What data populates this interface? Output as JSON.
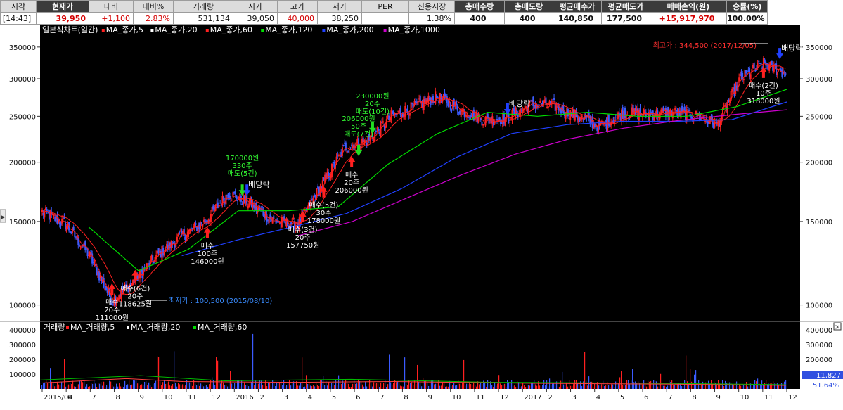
{
  "info_bar": {
    "headers": [
      "시각",
      "현재가",
      "대비",
      "대비%",
      "거래량",
      "시가",
      "고가",
      "저가",
      "PER",
      "신용시장",
      "총매수량",
      "총매도량",
      "평균매수가",
      "평균매도가",
      "매매손익(원)",
      "승률(%)"
    ],
    "values": [
      "[14:43]",
      "39,950",
      "+1,100",
      "2.83%",
      "531,134",
      "39,050",
      "40,000",
      "38,250",
      "",
      "1.38%",
      "400",
      "400",
      "140,850",
      "177,500",
      "+15,917,970",
      "100.00%"
    ]
  },
  "colors": {
    "background": "#000000",
    "candle_up": "#ff2020",
    "candle_down": "#3b5bff",
    "ma5": "#ff2020",
    "ma20": "#ffffff",
    "ma60": "#ff2020",
    "ma120": "#00dd00",
    "ma200": "#2040ff",
    "ma1000": "#cc00cc",
    "buy_arrow": "#ff2020",
    "sell_arrow": "#22dd22",
    "buy_text": "#ffffff",
    "sell_text": "#33ff33",
    "high_label": "#ff3030",
    "low_label": "#3a8cff",
    "volume_line": "#ff4040",
    "volume_ma20": "#00bb00",
    "volume_ma60": "#ffaa00"
  },
  "chart_data": [
    {
      "type": "candlestick",
      "legend": {
        "title": "일본식차트(일간)",
        "items": [
          {
            "label": "MA_종가,5",
            "color": "#ff2020"
          },
          {
            "label": "MA_종가,20",
            "color": "#ffffff"
          },
          {
            "label": "MA_종가,60",
            "color": "#ff2020"
          },
          {
            "label": "MA_종가,120",
            "color": "#00dd00"
          },
          {
            "label": "MA_종가,200",
            "color": "#2040ff"
          },
          {
            "label": "MA_종가,1000",
            "color": "#cc00cc"
          }
        ]
      },
      "y_scale": "log",
      "ylim": [
        92000,
        372000
      ],
      "y_ticks": [
        100000,
        150000,
        200000,
        250000,
        300000,
        350000
      ],
      "y_tick_labels": [
        "100000",
        "150000",
        "200000",
        "250000",
        "300000",
        "350000"
      ],
      "x_labels": [
        "2015/04",
        "6",
        "7",
        "8",
        "9",
        "10",
        "11",
        "12",
        "2016",
        "2",
        "3",
        "4",
        "5",
        "6",
        "7",
        "8",
        "9",
        "10",
        "11",
        "12",
        "2017",
        "2",
        "3",
        "4",
        "5",
        "6",
        "7",
        "8",
        "9",
        "10",
        "11",
        "12"
      ],
      "monthly_closes": [
        {
          "x": "2015/04",
          "close": 157000
        },
        {
          "x": "5",
          "close": 148000
        },
        {
          "x": "6",
          "close": 128000
        },
        {
          "x": "7",
          "close": 102000
        },
        {
          "x": "8",
          "close": 113000
        },
        {
          "x": "9",
          "close": 128000
        },
        {
          "x": "10",
          "close": 140000
        },
        {
          "x": "11",
          "close": 150000
        },
        {
          "x": "12",
          "close": 172000
        },
        {
          "x": "2016",
          "close": 163000
        },
        {
          "x": "2",
          "close": 150000
        },
        {
          "x": "3",
          "close": 148000
        },
        {
          "x": "4",
          "close": 178000
        },
        {
          "x": "5",
          "close": 215000
        },
        {
          "x": "6",
          "close": 222000
        },
        {
          "x": "7",
          "close": 250000
        },
        {
          "x": "8",
          "close": 262000
        },
        {
          "x": "9",
          "close": 275000
        },
        {
          "x": "10",
          "close": 258000
        },
        {
          "x": "11",
          "close": 245000
        },
        {
          "x": "12",
          "close": 248000
        },
        {
          "x": "2017",
          "close": 265000
        },
        {
          "x": "2",
          "close": 263000
        },
        {
          "x": "3",
          "close": 250000
        },
        {
          "x": "4",
          "close": 238000
        },
        {
          "x": "5",
          "close": 255000
        },
        {
          "x": "6",
          "close": 252000
        },
        {
          "x": "7",
          "close": 255000
        },
        {
          "x": "8",
          "close": 252000
        },
        {
          "x": "9",
          "close": 240000
        },
        {
          "x": "10",
          "close": 300000
        },
        {
          "x": "11",
          "close": 322000
        },
        {
          "x": "12",
          "close": 308000
        }
      ],
      "moving_averages": {
        "ma120": [
          {
            "x": "6",
            "y": 146000
          },
          {
            "x": "8",
            "y": 118000
          },
          {
            "x": "10",
            "y": 131000
          },
          {
            "x": "12",
            "y": 158000
          },
          {
            "x": "2",
            "y": 158000
          },
          {
            "x": "4",
            "y": 161000
          },
          {
            "x": "6",
            "y": 198000
          },
          {
            "x": "8",
            "y": 230000
          },
          {
            "x": "10",
            "y": 255000
          },
          {
            "x": "12",
            "y": 250000
          },
          {
            "x": "2",
            "y": 255000
          },
          {
            "x": "5",
            "y": 250000
          },
          {
            "x": "8",
            "y": 250000
          },
          {
            "x": "10",
            "y": 262000
          },
          {
            "x": "12",
            "y": 285000
          }
        ],
        "ma200": [
          {
            "x": "10",
            "y": 127000
          },
          {
            "x": "12",
            "y": 137000
          },
          {
            "x": "2",
            "y": 146000
          },
          {
            "x": "4",
            "y": 156000
          },
          {
            "x": "6",
            "y": 176000
          },
          {
            "x": "8",
            "y": 205000
          },
          {
            "x": "10",
            "y": 230000
          },
          {
            "x": "12",
            "y": 240000
          },
          {
            "x": "3",
            "y": 244000
          },
          {
            "x": "6",
            "y": 244000
          },
          {
            "x": "9",
            "y": 246000
          },
          {
            "x": "12",
            "y": 268000
          }
        ],
        "ma1000": [
          {
            "x": "3",
            "y": 140000
          },
          {
            "x": "5",
            "y": 150000
          },
          {
            "x": "7",
            "y": 168000
          },
          {
            "x": "9",
            "y": 188000
          },
          {
            "x": "11",
            "y": 208000
          },
          {
            "x": "2017",
            "y": 224000
          },
          {
            "x": "4",
            "y": 236000
          },
          {
            "x": "7",
            "y": 245000
          },
          {
            "x": "10",
            "y": 252000
          },
          {
            "x": "12",
            "y": 258000
          }
        ]
      },
      "trade_marks": [
        {
          "side": "buy",
          "x": "7",
          "price": 111000,
          "lines": [
            "매수",
            "20주",
            "111000원"
          ]
        },
        {
          "side": "buy",
          "x": "8",
          "price": 118625,
          "lines": [
            "매수(6건)",
            "20주",
            "118625원"
          ]
        },
        {
          "side": "buy",
          "x": "11",
          "price": 146000,
          "lines": [
            "매수",
            "100주",
            "146000원"
          ]
        },
        {
          "side": "sell",
          "x": "12",
          "price": 170000,
          "lines": [
            "170000원",
            "330주",
            "매도(5건)"
          ]
        },
        {
          "side": "buy",
          "x": "3",
          "price": 157750,
          "lines": [
            "매수(3건)",
            "20주",
            "157750원"
          ]
        },
        {
          "side": "buy",
          "x": "4",
          "price": 178000,
          "lines": [
            "매수(5건)",
            "30주",
            "178000원"
          ]
        },
        {
          "side": "buy",
          "x": "5",
          "price": 206000,
          "lines": [
            "매수",
            "20주",
            "206000원"
          ]
        },
        {
          "side": "sell",
          "x": "5",
          "price": 206000,
          "lines": [
            "206000원",
            "50주",
            "매도(7건)"
          ]
        },
        {
          "side": "sell",
          "x": "6",
          "price": 230000,
          "lines": [
            "230000원",
            "20주",
            "매도(10건)"
          ]
        },
        {
          "side": "buy",
          "x": "12",
          "price": 318000,
          "lines": [
            "매수(2건)",
            "10주",
            "318000원"
          ]
        }
      ],
      "dividend_marks": [
        {
          "x": "1",
          "label": "배당락"
        },
        {
          "x": "12",
          "label": "배당락"
        },
        {
          "x": "12",
          "label": "배당락"
        }
      ],
      "annotations": {
        "high": "최고가 : 344,500 (2017/12/05)",
        "low": "최저가 : 100,500 (2015/08/10)"
      }
    },
    {
      "type": "bar",
      "legend": {
        "title": "거래량",
        "items": [
          {
            "label": "MA_거래량,5",
            "color": "#ff2020"
          },
          {
            "label": "MA_거래량,20",
            "color": "#ffffff"
          },
          {
            "label": "MA_거래량,60",
            "color": "#00dd00"
          }
        ]
      },
      "ylim": [
        0,
        420000
      ],
      "y_ticks": [
        100000,
        200000,
        300000,
        400000
      ],
      "y_tick_labels": [
        "100000",
        "200000",
        "300000",
        "400000"
      ],
      "current_value": "11,827",
      "current_percent": "51.64%"
    }
  ]
}
